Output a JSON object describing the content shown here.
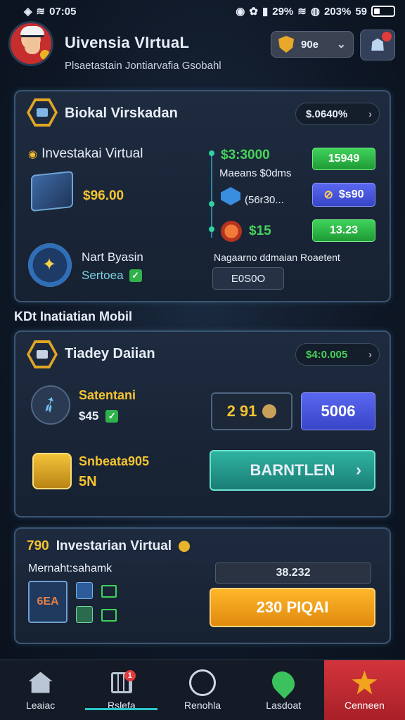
{
  "status_bar": {
    "time": "07:05",
    "battery_a": "29%",
    "battery_b": "203%",
    "extra": "59"
  },
  "header": {
    "title": "Uivensia VIrtuaL",
    "subtitle": "Plsaetastain Jontiarvafia Gsobahl",
    "coin_amount": "90e"
  },
  "card1": {
    "title": "Biokal Virskadan",
    "balance_pill": "$.0640%",
    "investment_label": "Investakai Virtual",
    "investment_amount": "$96.00",
    "rows": [
      {
        "value": "$3:3000",
        "button": "15949"
      },
      {
        "value": "Maeans $0dms",
        "button": ""
      },
      {
        "value": "(56r30...",
        "button": "$s90"
      },
      {
        "value": "$15",
        "button": "13.23"
      }
    ],
    "compass_label": "Nart Byasin",
    "compass_status": "Sertoea",
    "footer_text": "Nagaarno ddmaian Roaetent",
    "footer_button": "E0S0O"
  },
  "section_label": "KDt Inatiatian Mobil",
  "card2": {
    "title": "Tiadey Daiian",
    "balance_pill": "$4:0.005",
    "item1_label": "Satentani",
    "item1_value": "$45",
    "item2_label": "Snbeata905",
    "item2_value": "5N",
    "counter": "2  91",
    "blue_button": "5006",
    "cta_button": "BARNTLEN"
  },
  "card3": {
    "title_prefix": "790",
    "title": "Investarian Virtual",
    "subtitle": "Mernaht:sahamk",
    "tile_label": "6EA",
    "value": "38.232",
    "cta_button": "230 PIQAI"
  },
  "bottom_nav": [
    {
      "label": "Leaiac",
      "icon": "home-icon"
    },
    {
      "label": "Rslefa",
      "icon": "calendar-icon",
      "badge": "1"
    },
    {
      "label": "Renohla",
      "icon": "chart-icon"
    },
    {
      "label": "Lasdoat",
      "icon": "location-icon"
    },
    {
      "label": "Cenneen",
      "icon": "star-icon"
    }
  ]
}
